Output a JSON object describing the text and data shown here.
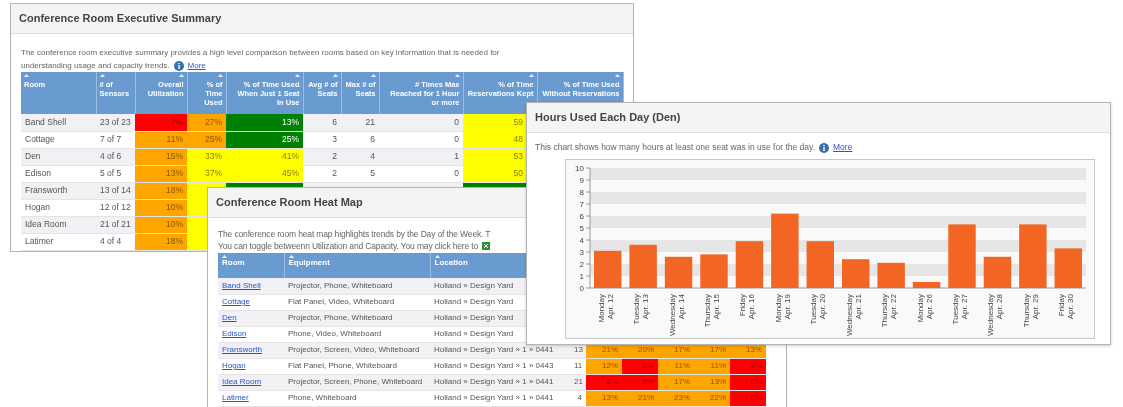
{
  "summary_card": {
    "title": "Conference Room Executive Summary",
    "description": "The conference room executive summary provides a high level comparison between rooms based on key information that is needed for understanding usage and capacity trends.",
    "more_link": "More",
    "columns": [
      "Room",
      "# of Sensors",
      "Overall Utilization",
      "% of Time Used",
      "% of Time Used When Just 1 Seat In Use",
      "Avg # of Seats",
      "Max # of Seats",
      "# Times Max Reached for 1 Hour or more",
      "% of Time Reservations Kept",
      "% of Time Used Without Reservations"
    ],
    "rows": [
      {
        "cells": [
          {
            "text": "Band Shell"
          },
          {
            "text": "23 of 23"
          },
          {
            "text": "7%",
            "color": "#ff0000"
          },
          {
            "text": "27%",
            "color": "#ffa500"
          },
          {
            "text": "13%",
            "color": "#008000"
          },
          {
            "text": "6"
          },
          {
            "text": "21"
          },
          {
            "text": "0"
          },
          {
            "text": "59",
            "color": "#ffff00"
          }
        ]
      },
      {
        "cells": [
          {
            "text": "Cottage"
          },
          {
            "text": "7 of 7"
          },
          {
            "text": "11%",
            "color": "#ffa500"
          },
          {
            "text": "25%",
            "color": "#ffa500"
          },
          {
            "text": "25%",
            "color": "#008000"
          },
          {
            "text": "3"
          },
          {
            "text": "6"
          },
          {
            "text": "0"
          },
          {
            "text": "48",
            "color": "#ffff00"
          }
        ]
      },
      {
        "cells": [
          {
            "text": "Den"
          },
          {
            "text": "4 of 6"
          },
          {
            "text": "15%",
            "color": "#ffa500"
          },
          {
            "text": "33%",
            "color": "#ffff00"
          },
          {
            "text": "41%",
            "color": "#ffff00"
          },
          {
            "text": "2"
          },
          {
            "text": "4"
          },
          {
            "text": "1"
          },
          {
            "text": "53",
            "color": "#ffff00"
          }
        ]
      },
      {
        "cells": [
          {
            "text": "Edison"
          },
          {
            "text": "5 of 5"
          },
          {
            "text": "13%",
            "color": "#ffa500"
          },
          {
            "text": "37%",
            "color": "#ffff00"
          },
          {
            "text": "45%",
            "color": "#ffff00"
          },
          {
            "text": "2"
          },
          {
            "text": "5"
          },
          {
            "text": "0"
          },
          {
            "text": "50",
            "color": "#ffff00"
          }
        ]
      },
      {
        "cells": [
          {
            "text": "Fransworth"
          },
          {
            "text": "13 of 14"
          },
          {
            "text": "18%",
            "color": "#ffa500"
          },
          {
            "color": "#ffff00"
          },
          {
            "color": "#008000"
          },
          {},
          {},
          {},
          {
            "color": "#008000"
          }
        ]
      },
      {
        "cells": [
          {
            "text": "Hogan"
          },
          {
            "text": "12 of 12"
          },
          {
            "text": "10%",
            "color": "#ffa500"
          },
          {
            "color": "#ffff00"
          }
        ]
      },
      {
        "cells": [
          {
            "text": "Idea Room"
          },
          {
            "text": "21 of 21"
          },
          {
            "text": "10%",
            "color": "#ffa500"
          },
          {
            "color": "#ffff00"
          }
        ]
      },
      {
        "cells": [
          {
            "text": "Latimer"
          },
          {
            "text": "4 of 4"
          },
          {
            "text": "18%",
            "color": "#ffa500"
          },
          {
            "color": "#ffff00"
          }
        ]
      }
    ]
  },
  "heat_map_card": {
    "title": "Conference Room Heat Map",
    "description_lines": [
      "The conference room heat map highlights trends by the Day of the Week. T",
      "You can toggle betweenn Utilization and Capacity. You may click here to"
    ],
    "columns": [
      "Room",
      "Equipment",
      "Location"
    ],
    "rows": [
      {
        "cells": [
          {
            "text": "Band Shell"
          },
          {
            "text": "Projector, Phone, Whiteboard"
          },
          {
            "text": "Holland » Design Yard"
          }
        ]
      },
      {
        "cells": [
          {
            "text": "Cottage"
          },
          {
            "text": "Flat Panel, Video, Whiteboard"
          },
          {
            "text": "Holland » Design Yard"
          }
        ]
      },
      {
        "cells": [
          {
            "text": "Den"
          },
          {
            "text": "Projector, Phone, Whiteboard"
          },
          {
            "text": "Holland » Design Yard"
          }
        ]
      },
      {
        "cells": [
          {
            "text": "Edison"
          },
          {
            "text": "Phone, Video, Whiteboard"
          },
          {
            "text": "Holland » Design Yard"
          }
        ]
      },
      {
        "cells": [
          {
            "text": "Fransworth"
          },
          {
            "text": "Projector, Screen, Video, Whiteboard"
          },
          {
            "text": "Holland » Design Yard » 1 » 0441"
          },
          {
            "text": "13"
          },
          {
            "text": "21%",
            "color": "#ffa500"
          },
          {
            "text": "20%",
            "color": "#ffa500"
          },
          {
            "text": "17%",
            "color": "#ffa500"
          },
          {
            "text": "17%",
            "color": "#ffa500"
          },
          {
            "text": "13%",
            "color": "#ffa500"
          }
        ]
      },
      {
        "cells": [
          {
            "text": "Hogan"
          },
          {
            "text": "Flat Panel, Phone, Whiteboard"
          },
          {
            "text": "Holland » Design Yard » 1 » 0443"
          },
          {
            "text": "11"
          },
          {
            "text": "12%",
            "color": "#ffa500"
          },
          {
            "text": "6%",
            "color": "#ff0000"
          },
          {
            "text": "11%",
            "color": "#ffa500"
          },
          {
            "text": "11%",
            "color": "#ffa500"
          },
          {
            "text": "4%",
            "color": "#ff0000"
          }
        ]
      },
      {
        "cells": [
          {
            "text": "Idea Room"
          },
          {
            "text": "Projector, Screen, Phone, Whiteboard"
          },
          {
            "text": "Holland » Design Yard » 1 » 0441"
          },
          {
            "text": "21"
          },
          {
            "text": "5%",
            "color": "#ff0000"
          },
          {
            "text": "6%",
            "color": "#ff0000"
          },
          {
            "text": "17%",
            "color": "#ffa500"
          },
          {
            "text": "13%",
            "color": "#ffa500"
          },
          {
            "text": "6%",
            "color": "#ff0000"
          }
        ]
      },
      {
        "cells": [
          {
            "text": "Latimer"
          },
          {
            "text": "Phone, Whiteboard"
          },
          {
            "text": "Holland » Design Yard » 1 » 0441"
          },
          {
            "text": "4"
          },
          {
            "text": "13%",
            "color": "#ffa500"
          },
          {
            "text": "21%",
            "color": "#ffa500"
          },
          {
            "text": "23%",
            "color": "#ffa500"
          },
          {
            "text": "22%",
            "color": "#ffa500"
          },
          {
            "text": "6%",
            "color": "#ff0000"
          }
        ]
      }
    ]
  },
  "chart_card": {
    "title": "Hours Used Each Day (Den)",
    "description": "This chart shows how many hours at least one seat was in use for the day.",
    "more_link": "More",
    "chart_data": {
      "type": "bar",
      "categories": [
        "Monday Apr. 12",
        "Tuesday Apr. 13",
        "Wednesday Apr. 14",
        "Thursday Apr. 15",
        "Friday Apr. 16",
        "Monday Apr. 19",
        "Tuesday Apr. 20",
        "Wednesday Apr. 21",
        "Thursday Apr. 22",
        "Monday Apr. 26",
        "Tuesday Apr. 27",
        "Wednesday Apr. 28",
        "Thursday Apr. 29",
        "Friday Apr. 30"
      ],
      "series": [
        {
          "color": "#f26522",
          "values": [
            3.1,
            3.6,
            2.6,
            2.8,
            3.9,
            6.2,
            3.9,
            2.4,
            2.1,
            0.5,
            5.3,
            2.6,
            5.3,
            3.3
          ]
        }
      ],
      "ylim": [
        0,
        10
      ],
      "yticks": [
        0,
        1,
        2,
        3,
        4,
        5,
        6,
        7,
        8,
        9,
        10
      ]
    }
  }
}
